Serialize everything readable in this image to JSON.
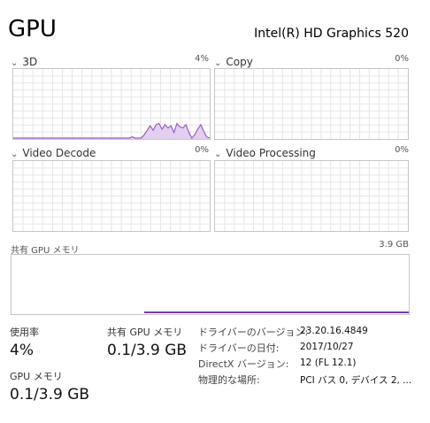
{
  "header": {
    "title": "GPU",
    "adapter_name": "Intel(R) HD Graphics 520"
  },
  "panels": [
    {
      "label": "3D",
      "value": "4%"
    },
    {
      "label": "Copy",
      "value": "0%"
    },
    {
      "label": "Video Decode",
      "value": "0%"
    },
    {
      "label": "Video Processing",
      "value": "0%"
    }
  ],
  "shared_memory": {
    "label": "共有 GPU メモリ",
    "value": "3.9 GB"
  },
  "stats": {
    "utilization": {
      "label": "使用率",
      "value": "4%"
    },
    "shared_gpu_memory": {
      "label": "共有 GPU メモリ",
      "value": "0.1/3.9 GB"
    },
    "gpu_memory": {
      "label": "GPU メモリ",
      "value": "0.1/3.9 GB"
    }
  },
  "info": [
    {
      "key": "ドライバーのバージョン:",
      "value": "23.20.16.4849"
    },
    {
      "key": "ドライバーの日付:",
      "value": "2017/10/27"
    },
    {
      "key": "DirectX バージョン:",
      "value": "12 (FL 12.1)"
    },
    {
      "key": "物理的な場所:",
      "value": "PCI バス 0, デバイス 2, ..."
    }
  ],
  "chart_data": {
    "type": "area",
    "series": [
      {
        "values": [
          0,
          0,
          0,
          0,
          0,
          0,
          0,
          0,
          0,
          0,
          0,
          0,
          0,
          0,
          0,
          0,
          0,
          0,
          0,
          0,
          0,
          0,
          0,
          0,
          0,
          0,
          0,
          0,
          0,
          0,
          0,
          0,
          0,
          0,
          0,
          0,
          0,
          0,
          0,
          0,
          1,
          0,
          0,
          0,
          3,
          7,
          11,
          7,
          12,
          13,
          8,
          12,
          9,
          11,
          5,
          13,
          10,
          9,
          12,
          5,
          0,
          3,
          8,
          12,
          6,
          1,
          0
        ]
      }
    ],
    "ylim": [
      0,
      100
    ],
    "colors": {
      "line": "#9b5fc0",
      "fill": "#e3cff0",
      "grid": "#e6e6e6",
      "memory_line": "#7a3bb0"
    }
  }
}
